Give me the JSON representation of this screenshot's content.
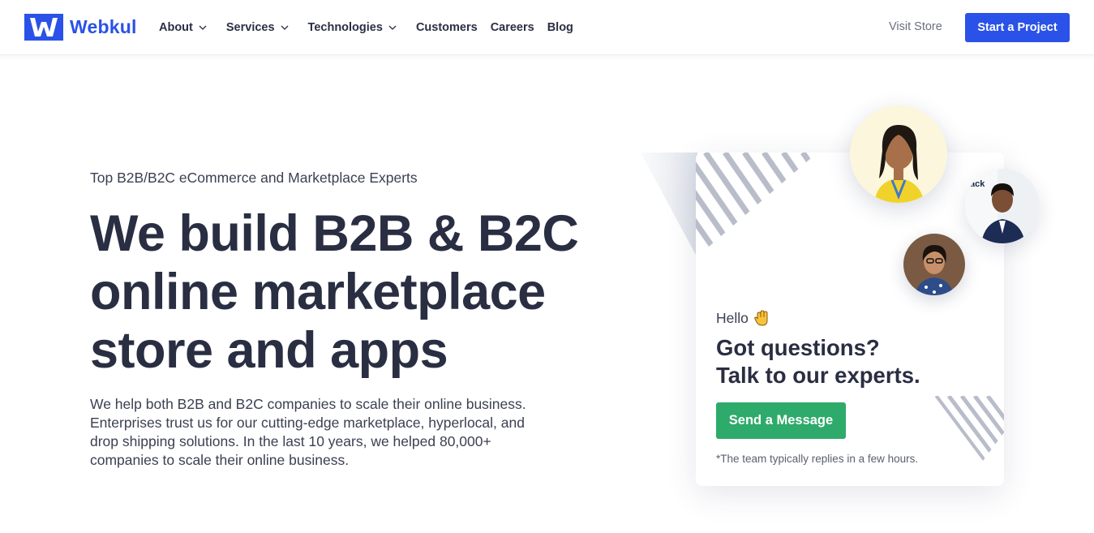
{
  "brand": {
    "name": "Webkul",
    "color": "#2a52e8"
  },
  "nav": {
    "items": [
      {
        "label": "About",
        "dropdown": true
      },
      {
        "label": "Services",
        "dropdown": true
      },
      {
        "label": "Technologies",
        "dropdown": true
      },
      {
        "label": "Customers",
        "dropdown": false
      },
      {
        "label": "Careers",
        "dropdown": false
      },
      {
        "label": "Blog",
        "dropdown": false
      }
    ],
    "visit_store": "Visit Store",
    "cta": "Start a Project"
  },
  "hero": {
    "eyebrow": "Top B2B/B2C eCommerce and Marketplace Experts",
    "headline_lines": [
      "We build B2B & B2C",
      "online marketplace",
      "store and apps"
    ],
    "sub_lines": [
      "We help both B2B and B2C companies to scale their online business.",
      "Enterprises trust us for our cutting-edge marketplace, hyperlocal, and",
      "drop shipping solutions. In the last 10 years, we helped 80,000+",
      "companies to scale their online business."
    ]
  },
  "chat": {
    "greeting": "Hello",
    "greeting_icon": "waving-hand-icon",
    "title_lines": [
      "Got questions?",
      "Talk to our experts."
    ],
    "button": "Send a Message",
    "button_color": "#2eaa6a",
    "note": "*The team typically replies in a few hours."
  }
}
